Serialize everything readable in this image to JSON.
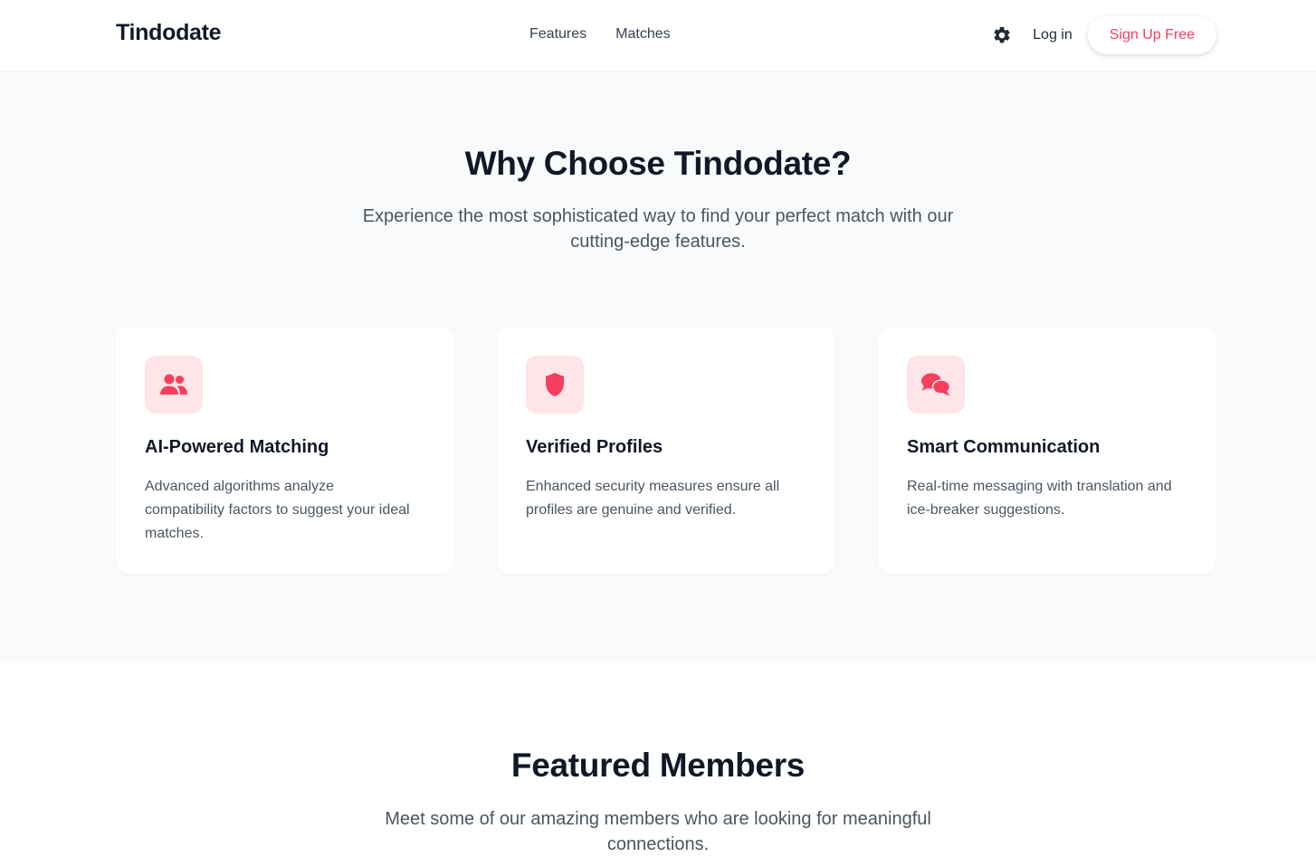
{
  "header": {
    "brand": "Tindodate",
    "nav": [
      {
        "label": "Features"
      },
      {
        "label": "Matches"
      }
    ],
    "theme_icon": "gear-icon",
    "login_label": "Log in",
    "signup_label": "Sign Up Free"
  },
  "features": {
    "title": "Why Choose Tindodate?",
    "subtitle": "Experience the most sophisticated way to find your perfect match with our cutting-edge features.",
    "cards": [
      {
        "icon": "users-icon",
        "title": "AI-Powered Matching",
        "description": "Advanced algorithms analyze compatibility factors to suggest your ideal matches."
      },
      {
        "icon": "shield-icon",
        "title": "Verified Profiles",
        "description": "Enhanced security measures ensure all profiles are genuine and verified."
      },
      {
        "icon": "chat-icon",
        "title": "Smart Communication",
        "description": "Real-time messaging with translation and ice-breaker suggestions."
      }
    ]
  },
  "members": {
    "title": "Featured Members",
    "subtitle": "Meet some of our amazing members who are looking for meaningful connections."
  },
  "colors": {
    "accent": "#f43f5e",
    "icon_bg": "#ffe4e8",
    "section_bg": "#f9fafb"
  }
}
